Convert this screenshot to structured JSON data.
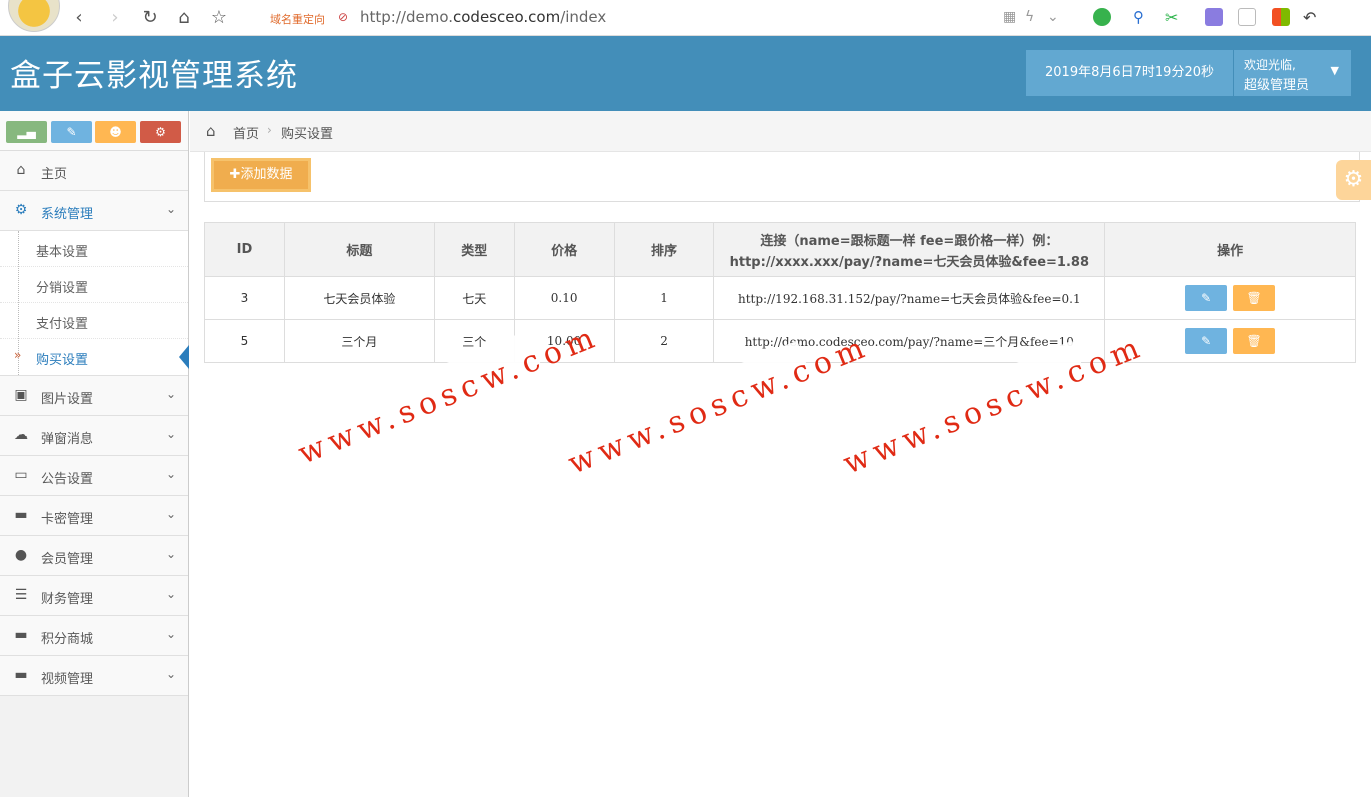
{
  "browser": {
    "redirect_label": "域名重定向",
    "url_prefix": "http://demo.",
    "url_host": "codesceo.com",
    "url_suffix": "/index"
  },
  "header": {
    "title": "盒子云影视管理系统",
    "datetime": "2019年8月6日7时19分20秒",
    "welcome": "欢迎光临,",
    "user": "超级管理员"
  },
  "sidebar": {
    "items": [
      {
        "label": "主页",
        "icon": "home-icon"
      },
      {
        "label": "系统管理",
        "icon": "cogs-icon",
        "open": true,
        "children": [
          "基本设置",
          "分销设置",
          "支付设置",
          "购买设置"
        ],
        "active_child": "购买设置"
      },
      {
        "label": "图片设置",
        "icon": "picture-icon"
      },
      {
        "label": "弹窗消息",
        "icon": "comments-icon"
      },
      {
        "label": "公告设置",
        "icon": "laptop-icon"
      },
      {
        "label": "卡密管理",
        "icon": "desktop-icon"
      },
      {
        "label": "会员管理",
        "icon": "user-icon"
      },
      {
        "label": "财务管理",
        "icon": "list-icon"
      },
      {
        "label": "积分商城",
        "icon": "desktop-icon"
      },
      {
        "label": "视频管理",
        "icon": "desktop-icon"
      }
    ]
  },
  "breadcrumb": {
    "home": "首页",
    "current": "购买设置"
  },
  "toolbar": {
    "add_label": "添加数据"
  },
  "table": {
    "headers": [
      "ID",
      "标题",
      "类型",
      "价格",
      "排序",
      "连接（name=跟标题一样 fee=跟价格一样）例：",
      "操作"
    ],
    "header_example": "http://xxxx.xxx/pay/?name=七天会员体验&fee=1.88",
    "rows": [
      {
        "id": "3",
        "title": "七天会员体验",
        "type": "七天",
        "price": "0.10",
        "sort": "1",
        "link": "http://192.168.31.152/pay/?name=七天会员体验&fee=0.1"
      },
      {
        "id": "5",
        "title": "三个月",
        "type": "三个",
        "price": "10.00",
        "sort": "2",
        "link": "http://demo.codesceo.com/pay/?name=三个月&fee=10"
      }
    ]
  },
  "watermark": "www.soscw.com"
}
